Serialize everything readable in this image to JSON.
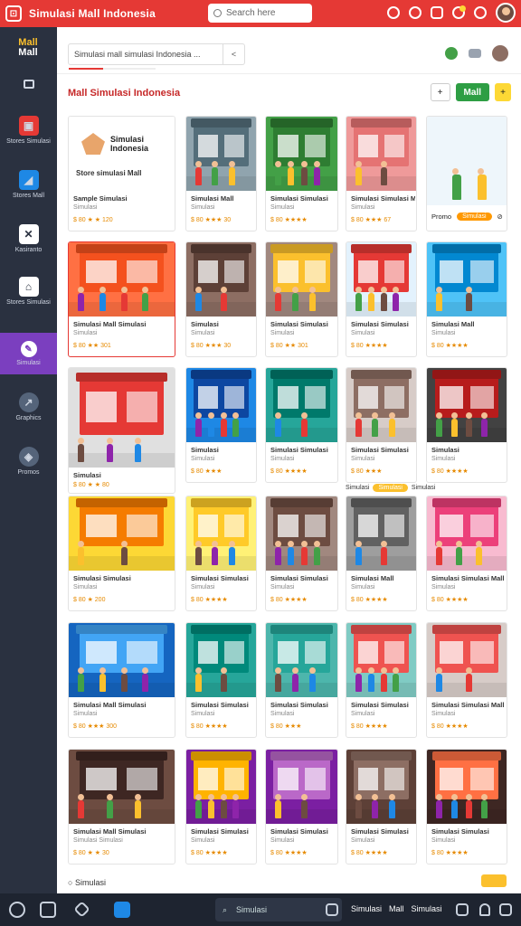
{
  "app": {
    "title": "Simulasi Mall Indonesia",
    "logo_text": "⊡"
  },
  "topbar": {
    "search_placeholder": "Search here",
    "icons": [
      "location-icon",
      "help-icon",
      "gallery-icon",
      "bell-icon",
      "settings-icon"
    ]
  },
  "sidebar": {
    "logo_line1": "Mall",
    "logo_line2": "Mall",
    "items": [
      {
        "icon": "home-icon",
        "label": ""
      },
      {
        "icon": "store-icon",
        "label": "Stores Simulasi"
      },
      {
        "icon": "map-icon",
        "label": "Stores Mall"
      },
      {
        "icon": "close-icon",
        "label": "Kasiranto"
      },
      {
        "icon": "house-icon",
        "label": "Stores Simulasi"
      },
      {
        "icon": "pencil-icon",
        "label": "Simulasi"
      },
      {
        "icon": "chart-icon",
        "label": "Graphics"
      },
      {
        "icon": "box-icon",
        "label": "Promos"
      }
    ]
  },
  "subbar": {
    "search_value": "Simulasi mall simulasi Indonesia ...",
    "search_btn": "<",
    "progress": 0.4
  },
  "heading": "Mall Simulasi Indonesia",
  "header_buttons": {
    "add": "+",
    "primary": "Mall",
    "extra": "+"
  },
  "cards": [
    {
      "title": "Sample Simulasi",
      "sub": "Simulasi",
      "meta": "$ 80 ★ ★ 120",
      "kind": "ad",
      "ad_title": "Simulasi Indonesia",
      "ad_sub": "Store simulasi Mall"
    },
    {
      "title": "Simulasi Mall",
      "sub": "Simulasi",
      "meta": "$ 80 ★★★ 30"
    },
    {
      "title": "Simulasi Simulasi",
      "sub": "Simulasi",
      "meta": "$ 80 ★★★★"
    },
    {
      "title": "Simulasi Simulasi Mall",
      "sub": "Simulasi",
      "meta": "$ 80 ★★★ 67"
    },
    {
      "title": "",
      "sub": "",
      "meta": "",
      "kind": "promo",
      "promo_label": "Promo",
      "promo_pill": "Simulasi"
    },
    {
      "title": "Simulasi Mall Simulasi",
      "sub": "Simulasi",
      "meta": "$ 80 ★★ 301",
      "selected": true
    },
    {
      "title": "Simulasi",
      "sub": "Simulasi",
      "meta": "$ 80 ★★★ 30"
    },
    {
      "title": "Simulasi Simulasi",
      "sub": "Simulasi",
      "meta": "$ 80 ★★ 301"
    },
    {
      "title": "Simulasi Simulasi",
      "sub": "Simulasi",
      "meta": "$ 80 ★★★★"
    },
    {
      "title": "Simulasi Mall",
      "sub": "Simulasi",
      "meta": "$ 80 ★★★★"
    },
    {
      "title": "Simulasi",
      "sub": "Simulasi",
      "meta": "$ 80 ★ ★ 80",
      "kind": "wide"
    },
    {
      "title": "Simulasi",
      "sub": "Simulasi",
      "meta": "$ 80 ★★★"
    },
    {
      "title": "Simulasi Simulasi",
      "sub": "Simulasi",
      "meta": "$ 80 ★★★★"
    },
    {
      "title": "Simulasi Simulasi",
      "sub": "Simulasi",
      "meta": "$ 80 ★★★"
    },
    {
      "title": "Simulasi",
      "sub": "Simulasi",
      "meta": "$ 80 ★★★★"
    },
    {
      "title": "Simulasi Simulasi",
      "sub": "Simulasi",
      "meta": "$ 80 ★ 200"
    },
    {
      "title": "Simulasi Simulasi",
      "sub": "Simulasi",
      "meta": "$ 80 ★★★★"
    },
    {
      "title": "Simulasi Simulasi",
      "sub": "Simulasi",
      "meta": "$ 80 ★★★★"
    },
    {
      "title": "Simulasi Mall",
      "sub": "Simulasi",
      "meta": "$ 80 ★★★★"
    },
    {
      "title": "Simulasi Simulasi Mall",
      "sub": "Simulasi",
      "meta": "$ 80 ★★★★"
    },
    {
      "title": "Simulasi Mall Simulasi",
      "sub": "Simulasi",
      "meta": "$ 80 ★★★ 300"
    },
    {
      "title": "Simulasi Simulasi",
      "sub": "Simulasi",
      "meta": "$ 80 ★★★★"
    },
    {
      "title": "Simulasi Simulasi",
      "sub": "Simulasi",
      "meta": "$ 80 ★★★"
    },
    {
      "title": "Simulasi Simulasi",
      "sub": "Simulasi",
      "meta": "$ 80 ★★★★"
    },
    {
      "title": "Simulasi Simulasi Mall",
      "sub": "Simulasi",
      "meta": "$ 80 ★★★★"
    },
    {
      "title": "Simulasi Mall Simulasi",
      "sub": "Simulasi Simulasi",
      "meta": "$ 80 ★ ★ 30"
    },
    {
      "title": "Simulasi Simulasi",
      "sub": "Simulasi",
      "meta": "$ 80 ★★★★"
    },
    {
      "title": "Simulasi Simulasi",
      "sub": "Simulasi",
      "meta": "$ 80 ★★★★"
    },
    {
      "title": "Simulasi Simulasi",
      "sub": "Simulasi",
      "meta": "$ 80 ★★★★"
    },
    {
      "title": "Simulasi Simulasi",
      "sub": "Simulasi",
      "meta": "$ 80 ★★★★"
    }
  ],
  "midtag": {
    "label": "Simulasi",
    "pill": "Simulasi",
    "extra": "Simulasi"
  },
  "footer": {
    "label": "Simulasi"
  },
  "taskbar": {
    "search": "Simulasi",
    "items": [
      "Simulasi",
      "Mall",
      "Simulasi"
    ]
  },
  "colors": {
    "accent": "#e53935",
    "sidebar": "#2a3140",
    "active": "#7b3fbf",
    "primary_btn": "#2e9e44",
    "star": "#e68a00"
  }
}
